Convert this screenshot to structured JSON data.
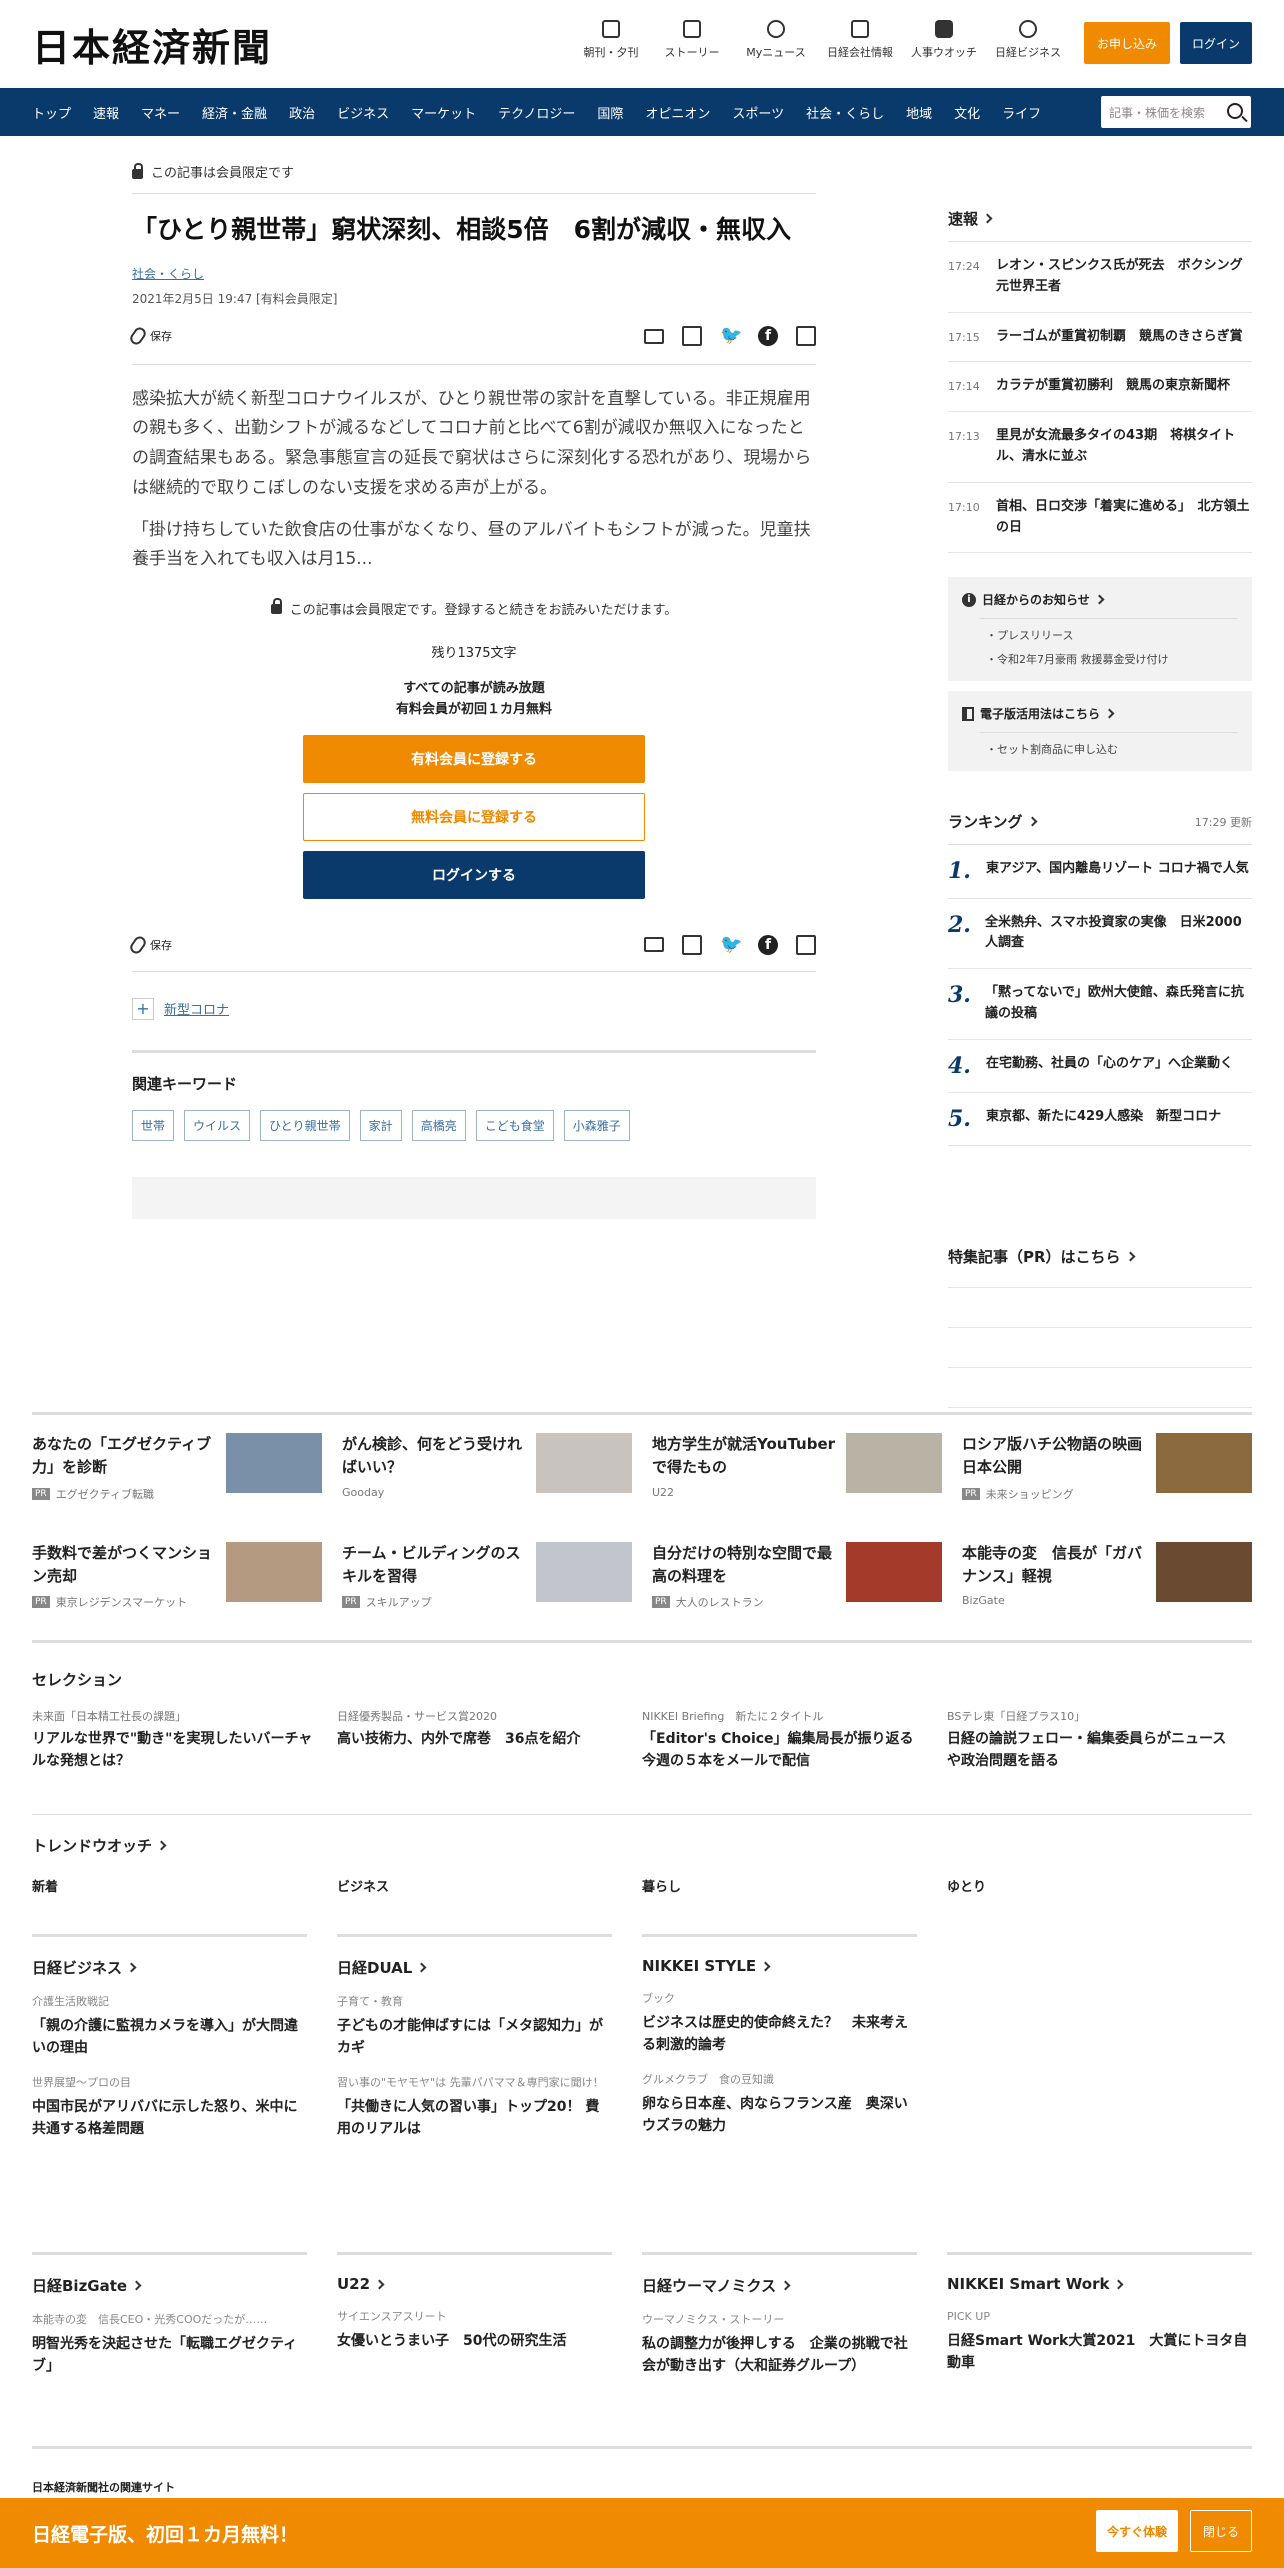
{
  "header": {
    "logo": "日本経済新聞",
    "links": [
      {
        "label": "朝刊・夕刊",
        "icon": "newspaper-icon"
      },
      {
        "label": "ストーリー",
        "icon": "book-icon"
      },
      {
        "label": "Myニュース",
        "icon": "user-icon"
      },
      {
        "label": "日経会社情報",
        "icon": "chart-icon"
      },
      {
        "label": "人事ウオッチ",
        "icon": "search-person-icon"
      },
      {
        "label": "日経ビジネス",
        "icon": "compass-icon"
      }
    ],
    "subscribe": "お申し込み",
    "login": "ログイン"
  },
  "nav": {
    "items": [
      "トップ",
      "速報",
      "マネー",
      "経済・金融",
      "政治",
      "ビジネス",
      "マーケット",
      "テクノロジー",
      "国際",
      "オピニオン",
      "スポーツ",
      "社会・くらし",
      "地域",
      "文化",
      "ライフ"
    ],
    "search_placeholder": "記事・株価を検索"
  },
  "article": {
    "members_note": "この記事は会員限定です",
    "headline": "「ひとり親世帯」窮状深刻、相談5倍　6割が減収・無収入",
    "category": "社会・くらし",
    "date": "2021年2月5日 19:47 [有料会員限定]",
    "save": "保存",
    "p1": "感染拡大が続く新型コロナウイルスが、ひとり親世帯の家計を直撃している。非正規雇用の親も多く、出勤シフトが減るなどしてコロナ前と比べて6割が減収か無収入になったとの調査結果もある。緊急事態宣言の延長で窮状はさらに深刻化する恐れがあり、現場からは継続的で取りこぼしのない支援を求める声が上がる。",
    "p2": "「掛け持ちしていた飲食店の仕事がなくなり、昼のアルバイトもシフトが減った。児童扶養手当を入れても収入は月15...",
    "locked_msg": "この記事は会員限定です。登録すると続きをお読みいただけます。",
    "remain": "残り1375文字",
    "benefit1": "すべての記事が読み放題",
    "benefit2": "有料会員が初回１カ月無料",
    "cta_paid": "有料会員に登録する",
    "cta_free": "無料会員に登録する",
    "cta_login": "ログインする",
    "topic": "新型コロナ",
    "keywords_title": "関連キーワード",
    "keywords": [
      "世帯",
      "ウイルス",
      "ひとり親世帯",
      "家計",
      "高橋亮",
      "こども食堂",
      "小森雅子"
    ]
  },
  "sidebar": {
    "flash_title": "速報",
    "flash": [
      {
        "time": "17:24",
        "title": "レオン・スピンクス氏が死去　ボクシング元世界王者"
      },
      {
        "time": "17:15",
        "title": "ラーゴムが重賞初制覇　競馬のきさらぎ賞"
      },
      {
        "time": "17:14",
        "title": "カラテが重賞初勝利　競馬の東京新聞杯"
      },
      {
        "time": "17:13",
        "title": "里見が女流最多タイの43期　将棋タイトル、清水に並ぶ"
      },
      {
        "time": "17:10",
        "title": "首相、日ロ交渉「着実に進める」　北方領土の日"
      }
    ],
    "notice_title": "日経からのお知らせ",
    "notices": [
      "プレスリリース",
      "令和2年7月豪雨 救援募金受け付け"
    ],
    "edigital_title": "電子版活用法はこちら",
    "edigital_items": [
      "セット割商品に申し込む"
    ],
    "ranking_title": "ランキング",
    "ranking_updated": "17:29  更新",
    "ranking": [
      {
        "num": "1.",
        "title": "東アジア、国内離島リゾート コロナ禍で人気"
      },
      {
        "num": "2.",
        "title": "全米熱弁、スマホ投資家の実像　日米2000人調査"
      },
      {
        "num": "3.",
        "title": "「黙ってないで」欧州大使館、森氏発言に抗議の投稿"
      },
      {
        "num": "4.",
        "title": "在宅勤務、社員の「心のケア」へ企業動く"
      },
      {
        "num": "5.",
        "title": "東京都、新たに429人感染　新型コロナ"
      }
    ],
    "pr_title": "特集記事（PR）はこちら"
  },
  "promos": [
    {
      "title": "あなたの「エグゼクティブ力」を診断",
      "src": "エグゼクティブ転職",
      "pr": true,
      "color": "#7a90a8"
    },
    {
      "title": "がん検診、何をどう受ければいい？",
      "src": "Gooday",
      "pr": false,
      "color": "#c9c3bf"
    },
    {
      "title": "地方学生が就活YouTuberで得たもの",
      "src": "U22",
      "pr": false,
      "color": "#b9b3a6"
    },
    {
      "title": "ロシア版ハチ公物語の映画日本公開",
      "src": "未来ショッピング",
      "pr": true,
      "color": "#8a6a3e"
    },
    {
      "title": "手数料で差がつくマンション売却",
      "src": "東京レジデンスマーケット",
      "pr": true,
      "color": "#b39a80"
    },
    {
      "title": "チーム・ビルディングのスキルを習得",
      "src": "スキルアップ",
      "pr": true,
      "color": "#c2c6cc"
    },
    {
      "title": "自分だけの特別な空間で最高の料理を",
      "src": "大人のレストラン",
      "pr": true,
      "color": "#a33a2a"
    },
    {
      "title": "本能寺の変　信長が「ガバナンス」軽視",
      "src": "BizGate",
      "pr": false,
      "color": "#6a4b32"
    }
  ],
  "selection": {
    "title": "セレクション",
    "items": [
      {
        "kicker": "未来面「日本精工社長の課題」",
        "title": "リアルな世界で\"動き\"を実現したいバーチャルな発想とは？"
      },
      {
        "kicker": "日経優秀製品・サービス賞2020",
        "title": "高い技術力、内外で席巻　36点を紹介"
      },
      {
        "kicker": "NIKKEI Briefing　新たに２タイトル",
        "title": "「Editor's Choice」編集局長が振り返る今週の５本をメールで配信"
      },
      {
        "kicker": "BSテレ東「日経プラス10」",
        "title": "日経の論説フェロー・編集委員らがニュースや政治問題を語る"
      }
    ]
  },
  "trend": {
    "title": "トレンドウオッチ",
    "tabs": [
      "新着",
      "ビジネス",
      "暮らし",
      "ゆとり"
    ]
  },
  "media1": [
    {
      "name": "日経ビジネス",
      "items": [
        {
          "kicker": "介護生活敗戦記",
          "title": "「親の介護に監視カメラを導入」が大問違いの理由"
        },
        {
          "kicker": "世界展望～プロの目",
          "title": "中国市民がアリババに示した怒り、米中に共通する格差問題"
        }
      ]
    },
    {
      "name": "日経DUAL",
      "items": [
        {
          "kicker": "子育て・教育",
          "title": "子どもの才能伸ばすには「メタ認知力」がカギ"
        },
        {
          "kicker": "習い事の\"モヤモヤ\"は 先輩パパママ＆専門家に聞け！",
          "title": "「共働きに人気の習い事」トップ20！ 費用のリアルは"
        }
      ]
    },
    {
      "name": "NIKKEI STYLE",
      "items": [
        {
          "kicker": "ブック",
          "title": "ビジネスは歴史的使命終えた？　未来考える刺激的論考"
        },
        {
          "kicker": "グルメクラブ　食の豆知識",
          "title": "卵なら日本産、肉ならフランス産　奥深いウズラの魅力"
        }
      ]
    }
  ],
  "media2": [
    {
      "name": "日経BizGate",
      "kicker": "本能寺の変　信長CEO・光秀COOだったが……",
      "title": "明智光秀を決起させた「転職エグゼクティブ」"
    },
    {
      "name": "U22",
      "kicker": "サイエンスアスリート",
      "title": "女優いとうまい子　50代の研究生活"
    },
    {
      "name": "日経ウーマノミクス",
      "kicker": "ウーマノミクス・ストーリー",
      "title": "私の調整力が後押しする　企業の挑戦で社会が動き出す（大和証券グループ）"
    },
    {
      "name": "NIKKEI Smart Work",
      "kicker": "PICK UP",
      "title": "日経Smart Work大賞2021　大賞にトヨタ自動車"
    }
  ],
  "related_sites": "日本経済新聞社の関連サイト",
  "footer": {
    "text": "日経電子版、初回１カ月無料！",
    "try": "今すぐ体験",
    "close": "閉じる"
  },
  "colors": {
    "brand_navy": "#0a3a6b",
    "brand_orange": "#f08a00"
  }
}
